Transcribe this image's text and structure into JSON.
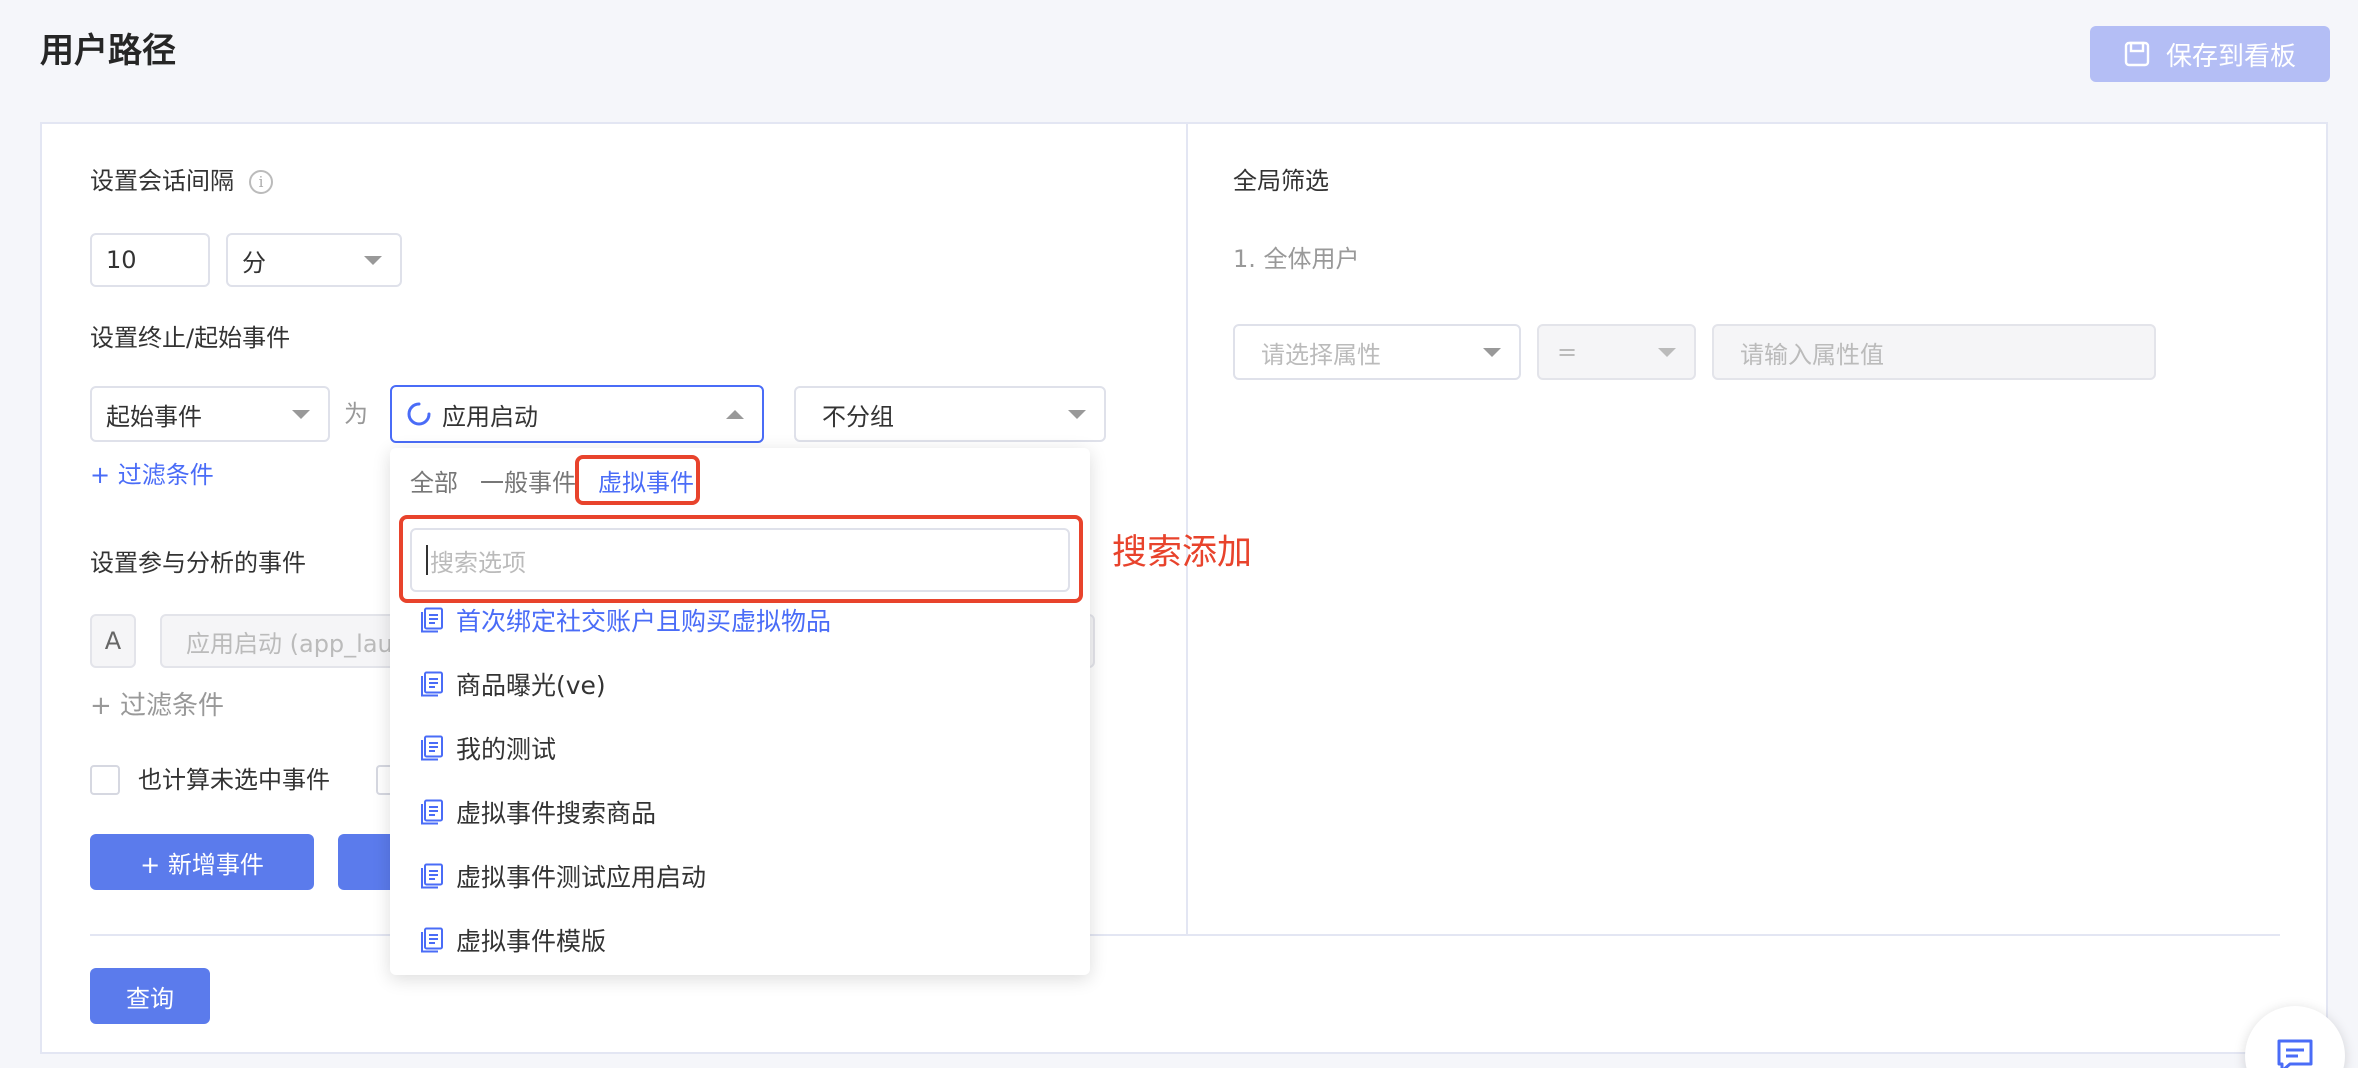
{
  "header": {
    "title": "用户路径",
    "save_button": "保存到看板",
    "save_icon": "save-icon"
  },
  "session": {
    "label": "设置会话间隔",
    "info_icon": "info-icon",
    "value": "10",
    "unit": "分"
  },
  "boundary": {
    "label": "设置终止/起始事件",
    "event_type": "起始事件",
    "connector": "为",
    "event_value": "应用启动",
    "group": "不分组",
    "filter_link": "+ 过滤条件"
  },
  "analysis": {
    "label": "设置参与分析的事件",
    "row_letter": "A",
    "row_placeholder": "应用启动 (app_laun",
    "filter_link": "+ 过滤条件",
    "checkbox_label": "也计算未选中事件",
    "add_button": "+ 新增事件"
  },
  "query_button": "查询",
  "global_filter": {
    "label": "全局筛选",
    "item": "1. 全体用户",
    "attr_placeholder": "请选择属性",
    "operator": "=",
    "value_placeholder": "请输入属性值"
  },
  "dropdown": {
    "tabs": [
      "全部",
      "一般事件",
      "虚拟事件"
    ],
    "active_tab": "虚拟事件",
    "search_placeholder": "搜索选项",
    "items": [
      "首次绑定社交账户且购买虚拟物品",
      "商品曝光(ve)",
      "我的测试",
      "虚拟事件搜索商品",
      "虚拟事件测试应用启动",
      "虚拟事件模版"
    ]
  },
  "annotation": {
    "text": "搜索添加",
    "color": "#e8432c"
  },
  "colors": {
    "primary": "#5b7bec",
    "link": "#4a6cf7",
    "save_disabled": "#b4bef5"
  }
}
